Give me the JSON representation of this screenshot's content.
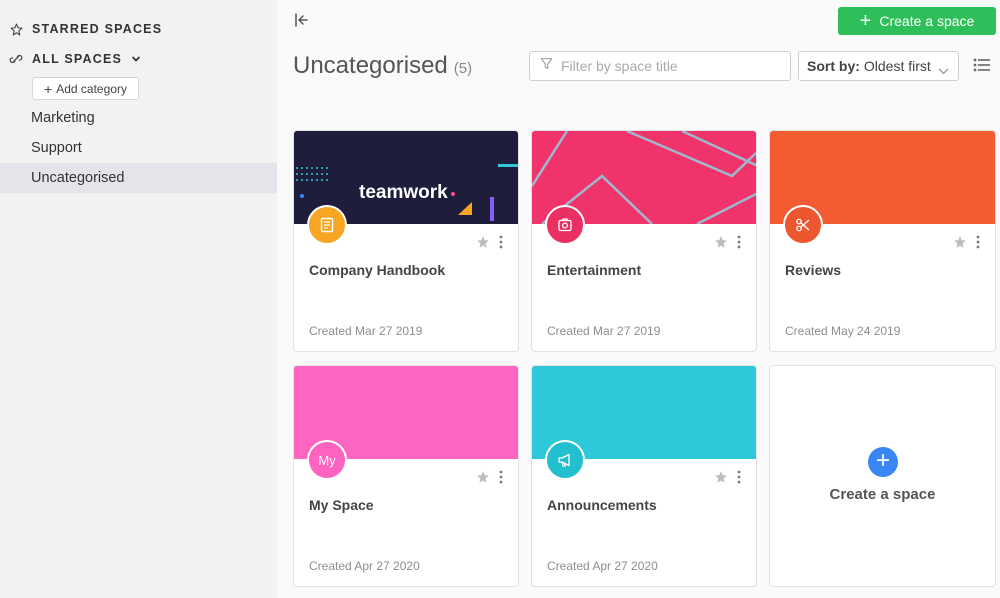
{
  "sidebar": {
    "starred_label": "STARRED SPACES",
    "all_spaces_label": "ALL SPACES",
    "add_category_label": "Add category",
    "categories": [
      {
        "label": "Marketing"
      },
      {
        "label": "Support"
      },
      {
        "label": "Uncategorised",
        "active": true
      }
    ]
  },
  "header": {
    "create_button_label": "Create a space",
    "title": "Uncategorised",
    "count": "(5)",
    "filter_placeholder": "Filter by space title",
    "sort_prefix": "Sort by:",
    "sort_value": "Oldest first"
  },
  "spaces": [
    {
      "name": "Company Handbook",
      "created": "Created Mar 27 2019",
      "banner_color": "#1f1d3c",
      "avatar_color": "#f6a623",
      "icon": "handbook-icon",
      "banner_text": "teamwork"
    },
    {
      "name": "Entertainment",
      "created": "Created Mar 27 2019",
      "banner_color": "#f0336a",
      "avatar_color": "#ea2f63",
      "icon": "camera-icon"
    },
    {
      "name": "Reviews",
      "created": "Created May 24 2019",
      "banner_color": "#f35b33",
      "avatar_color": "#ee5630",
      "icon": "scissors-icon"
    },
    {
      "name": "My Space",
      "created": "Created Apr 27 2020",
      "banner_color": "#ff66c4",
      "avatar_color": "#ff63c2",
      "avatar_text": "My"
    },
    {
      "name": "Announcements",
      "created": "Created Apr 27 2020",
      "banner_color": "#2ec9d8",
      "avatar_color": "#22bfcf",
      "icon": "megaphone-icon"
    }
  ],
  "create_card_label": "Create a space"
}
